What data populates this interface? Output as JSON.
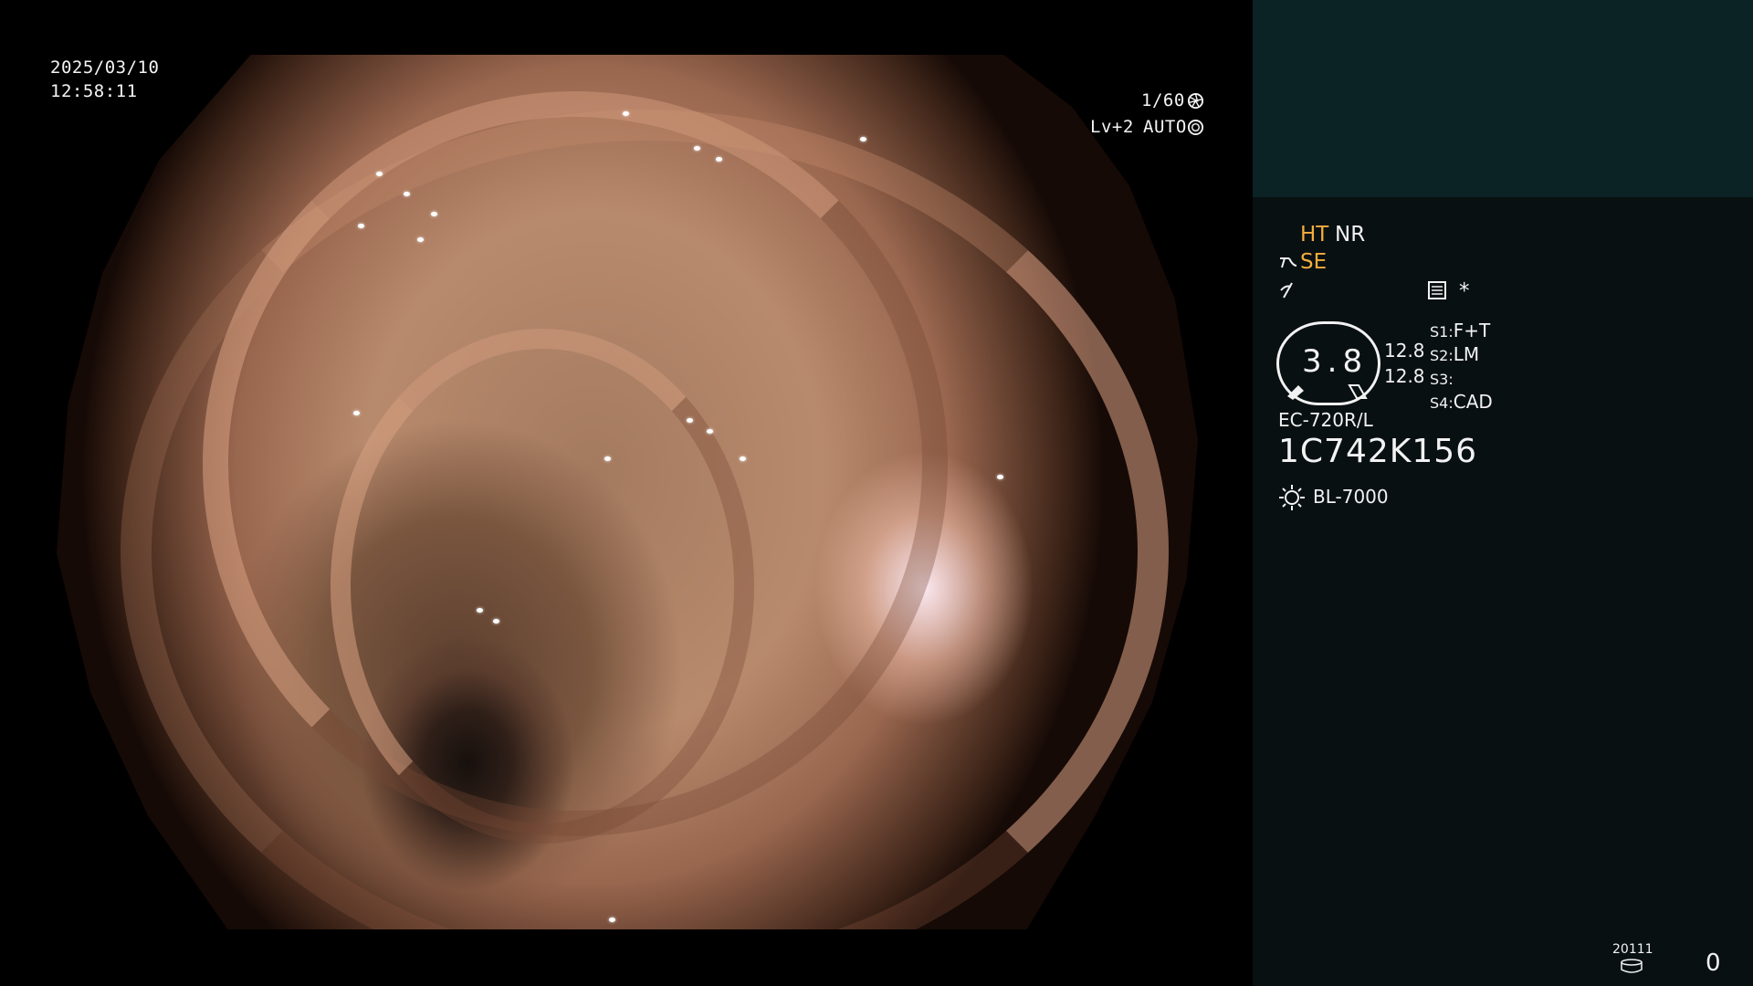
{
  "overlay": {
    "date": "2025/03/10",
    "time": "12:58:11",
    "shutter": "1/60",
    "level": "Lv+2",
    "iris_mode": "AUTO"
  },
  "panel": {
    "ht": "HT",
    "nr": "NR",
    "se": "SE",
    "star": "*",
    "gauge_value": "3.8",
    "values": [
      "12.8",
      "12.8"
    ],
    "switches": [
      {
        "key": "S1:",
        "value": "F+T"
      },
      {
        "key": "S2:",
        "value": "LM"
      },
      {
        "key": "S3:",
        "value": ""
      },
      {
        "key": "S4:",
        "value": "CAD"
      }
    ],
    "scope_model": "EC-720R/L",
    "serial": "1C742K156",
    "light_source": "BL-7000",
    "storage_code": "20111",
    "counter": "0"
  },
  "colors": {
    "panel_top": "#0c2325",
    "panel_bg": "#081012",
    "accent_orange": "#f6ad3e"
  },
  "icons": [
    "shutter-icon",
    "iris-icon",
    "structure-enhance-icon",
    "contrast-icon",
    "menu-icon",
    "light-source-icon",
    "storage-icon"
  ]
}
